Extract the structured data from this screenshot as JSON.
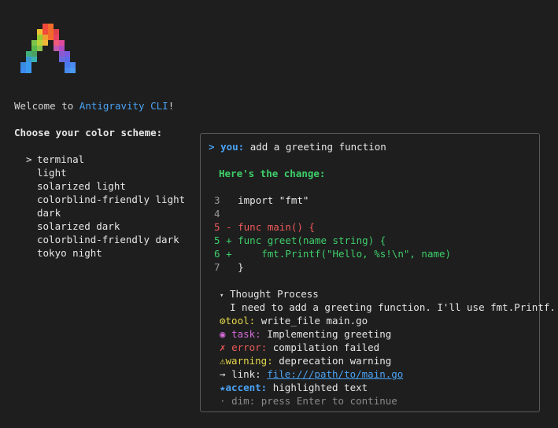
{
  "welcome": {
    "prefix": "Welcome to ",
    "app_name": "Antigravity CLI",
    "suffix": "!"
  },
  "prompt": "Choose your color scheme:",
  "schemes": {
    "cursor": ">",
    "items": [
      "terminal",
      "light",
      "solarized light",
      "colorblind-friendly light",
      "dark",
      "solarized dark",
      "colorblind-friendly dark",
      "tokyo night"
    ],
    "selected_index": 0
  },
  "preview": {
    "user_arrow": ">",
    "user_label": "you:",
    "user_message": "add a greeting function",
    "assistant_header": "Here's the change:",
    "diff": [
      {
        "num": "3",
        "sign": " ",
        "code": "import \"fmt\""
      },
      {
        "num": "4",
        "sign": " ",
        "code": ""
      },
      {
        "num": "5",
        "sign": "-",
        "code": "func main() {"
      },
      {
        "num": "5",
        "sign": "+",
        "code": "func greet(name string) {"
      },
      {
        "num": "6",
        "sign": "+",
        "code": "    fmt.Printf(\"Hello, %s!\\n\", name)"
      },
      {
        "num": "7",
        "sign": " ",
        "code": "}"
      }
    ],
    "thought_toggle": "▾",
    "thought_title": "Thought Process",
    "thought_text": "I need to add a greeting function. I'll use fmt.Printf.",
    "tool": {
      "icon": "⚙",
      "label": "tool:",
      "text": "write_file main.go"
    },
    "task": {
      "icon": "◉",
      "label": "task:",
      "text": "Implementing greeting"
    },
    "error": {
      "icon": "✗",
      "label": "error:",
      "text": "compilation failed"
    },
    "warning": {
      "icon": "⚠",
      "label": "warning:",
      "text": "deprecation warning"
    },
    "link": {
      "icon": "→",
      "label": "link:",
      "text": "file:///path/to/main.go"
    },
    "accent": {
      "icon": "★",
      "label": "accent:",
      "text": "highlighted text"
    },
    "dim": {
      "icon": "·",
      "label": "dim:",
      "text": "press Enter to continue"
    }
  },
  "colors": {
    "background": "#1e1e1e",
    "accent": "#4aa3f5",
    "success": "#3ecf6a",
    "error": "#f05a5a",
    "warning": "#e5d84a",
    "task": "#d56bd9",
    "muted": "#8a8a8a"
  }
}
